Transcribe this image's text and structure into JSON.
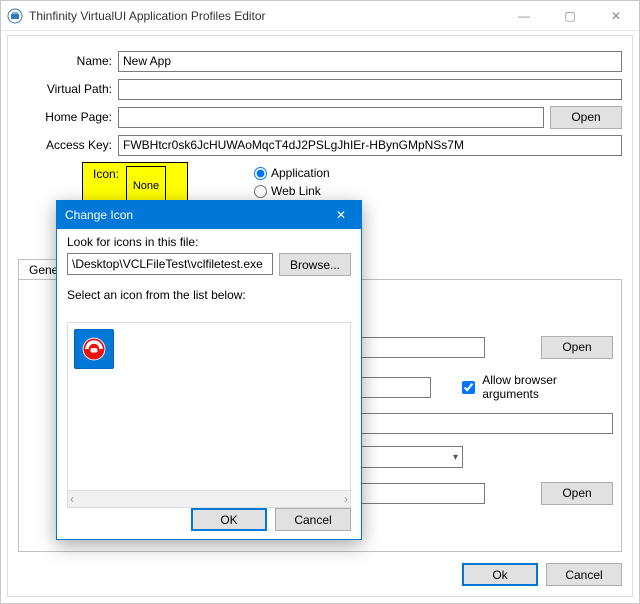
{
  "window": {
    "title": "Thinfinity VirtualUI Application Profiles Editor",
    "minimize": "—",
    "maximize": "▢",
    "close": "✕"
  },
  "form": {
    "name_label": "Name:",
    "name_value": "New App",
    "virtualpath_label": "Virtual Path:",
    "virtualpath_value": "",
    "homepage_label": "Home Page:",
    "homepage_value": "",
    "homepage_open": "Open",
    "accesskey_label": "Access Key:",
    "accesskey_value": "FWBHtcr0sk6JcHUWAoMqcT4dJ2PSLgJhIEr-HBynGMpNSs7M",
    "icon_label": "Icon:",
    "icon_none": "None",
    "radio_app": "Application",
    "radio_weblink": "Web Link",
    "radio_selected": "app"
  },
  "tabs": {
    "first": "Genera"
  },
  "tabpanel": {
    "open1": "Open",
    "allow_browser_args": "Allow browser arguments",
    "allow_checked": true,
    "open2": "Open"
  },
  "mainbuttons": {
    "ok": "Ok",
    "cancel": "Cancel"
  },
  "dialog": {
    "title": "Change Icon",
    "close": "✕",
    "lookfor_label": "Look for icons in this file:",
    "path_value": "\\Desktop\\VCLFileTest\\vclfiletest.exe",
    "browse": "Browse...",
    "select_label": "Select an icon from the list below:",
    "scroll_left": "‹",
    "scroll_right": "›",
    "ok": "OK",
    "cancel": "Cancel"
  }
}
